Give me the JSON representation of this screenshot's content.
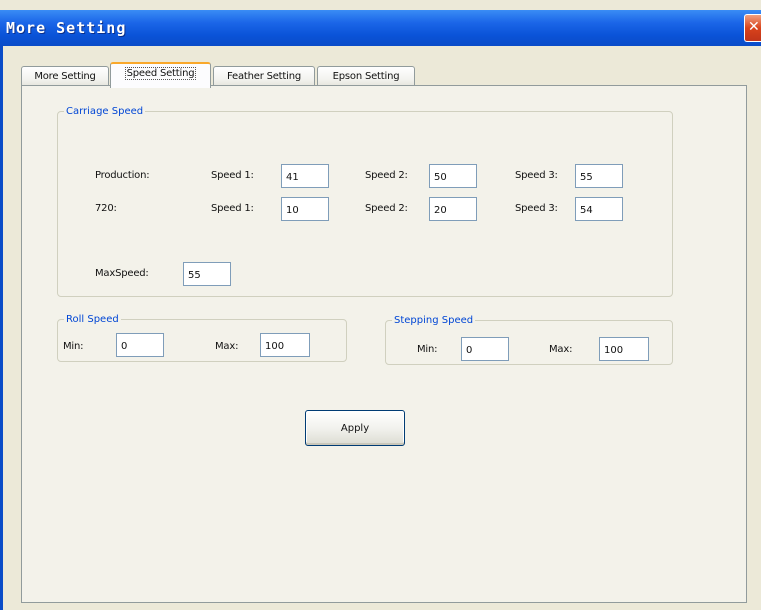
{
  "window": {
    "title": "More Setting",
    "close_glyph": "✕"
  },
  "tabs": [
    {
      "label": "More Setting"
    },
    {
      "label": "Speed Setting",
      "active": true
    },
    {
      "label": "Feather Setting"
    },
    {
      "label": "Epson Setting"
    }
  ],
  "carriage_speed": {
    "legend": "Carriage Speed",
    "rows": [
      {
        "label": "Production:",
        "speed1_label": "Speed 1:",
        "speed1": "41",
        "speed2_label": "Speed 2:",
        "speed2": "50",
        "speed3_label": "Speed 3:",
        "speed3": "55"
      },
      {
        "label": "720:",
        "speed1_label": "Speed 1:",
        "speed1": "10",
        "speed2_label": "Speed 2:",
        "speed2": "20",
        "speed3_label": "Speed 3:",
        "speed3": "54"
      }
    ],
    "max_speed_label": "MaxSpeed:",
    "max_speed": "55"
  },
  "roll_speed": {
    "legend": "Roll Speed",
    "min_label": "Min:",
    "min": "0",
    "max_label": "Max:",
    "max": "100"
  },
  "stepping_speed": {
    "legend": "Stepping Speed",
    "min_label": "Min:",
    "min": "0",
    "max_label": "Max:",
    "max": "100"
  },
  "apply_label": "Apply",
  "colors": {
    "titlebar": "#0a53d8",
    "legend_text": "#0046d5",
    "window_bg": "#ece9d8",
    "active_tab_accent": "#f9a82b"
  }
}
